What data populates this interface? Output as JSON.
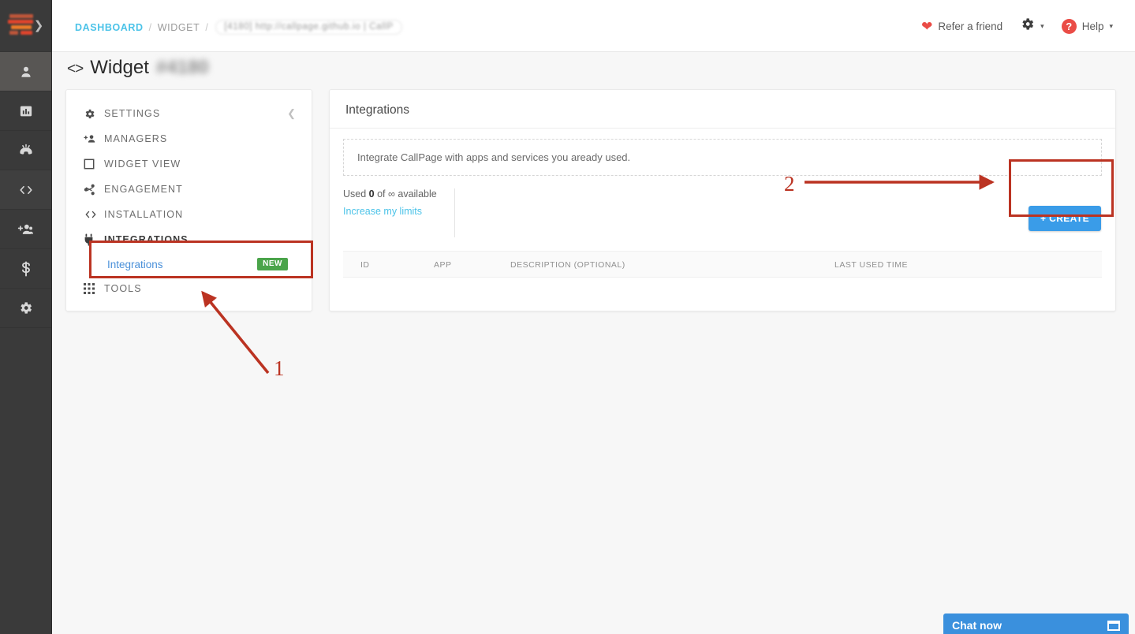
{
  "rail": {
    "logo_name": "callpage-logo",
    "expand_icon": "chevron-right-icon",
    "items": [
      {
        "icon": "person-icon",
        "name": "rail-item-leads",
        "state": "active"
      },
      {
        "icon": "bar-chart-icon",
        "name": "rail-item-analytics",
        "state": "default"
      },
      {
        "icon": "phone-ringing-icon",
        "name": "rail-item-calls",
        "state": "default"
      },
      {
        "icon": "code-brackets-icon",
        "name": "rail-item-widget",
        "state": "semi"
      },
      {
        "icon": "add-people-icon",
        "name": "rail-item-managers",
        "state": "default"
      },
      {
        "icon": "dollar-icon",
        "name": "rail-item-billing",
        "state": "default"
      },
      {
        "icon": "gear-icon",
        "name": "rail-item-settings",
        "state": "default"
      }
    ]
  },
  "header": {
    "breadcrumb": {
      "dashboard": "DASHBOARD",
      "separator": "/",
      "widget": "WIDGET",
      "pill": "[4180] http://callpage.github.io | CallP"
    },
    "refer_label": "Refer a friend",
    "refer_icon": "heart-icon",
    "gear_icon": "gear-icon",
    "gear_caret": "▾",
    "help_icon": "question-mark-icon",
    "help_label": "Help",
    "help_caret": "▾"
  },
  "page": {
    "title_icon": "<>",
    "title": "Widget",
    "title_id": "#4180"
  },
  "menu": {
    "collapse_icon": "chevron-left-icon",
    "items": [
      {
        "label": "SETTINGS",
        "icon": "gear-icon",
        "name": "menu-item-settings"
      },
      {
        "label": "MANAGERS",
        "icon": "add-person-icon",
        "name": "menu-item-managers"
      },
      {
        "label": "WIDGET VIEW",
        "icon": "square-icon",
        "name": "menu-item-widget-view"
      },
      {
        "label": "ENGAGEMENT",
        "icon": "share-icon",
        "name": "menu-item-engagement"
      },
      {
        "label": "INSTALLATION",
        "icon": "code-icon",
        "name": "menu-item-installation"
      },
      {
        "label": "INTEGRATIONS",
        "icon": "plug-icon",
        "name": "menu-item-integrations",
        "open": true
      },
      {
        "label": "TOOLS",
        "icon": "grid-dots-icon",
        "name": "menu-item-tools"
      }
    ],
    "submenu": {
      "label": "Integrations",
      "badge": "NEW"
    }
  },
  "panel": {
    "title": "Integrations",
    "info_text": "Integrate CallPage with apps and services you aready used.",
    "limits": {
      "prefix": "Used ",
      "used": "0",
      "middle": " of ∞ available",
      "link": "Increase my limits"
    },
    "create_button": "+ CREATE",
    "table": {
      "columns": [
        "ID",
        "APP",
        "DESCRIPTION (OPTIONAL)",
        "LAST USED TIME"
      ],
      "rows": []
    }
  },
  "annotations": {
    "markers": [
      "1",
      "2"
    ],
    "color": "#bb3322"
  },
  "chat": {
    "label": "Chat now",
    "minimize_icon": "window-icon"
  }
}
